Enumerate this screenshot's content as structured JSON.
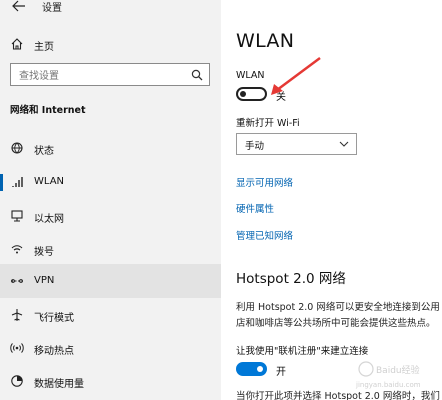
{
  "window": {
    "title": "设置"
  },
  "sidebar": {
    "home_label": "主页",
    "search_placeholder": "查找设置",
    "section_label": "网络和 Internet",
    "items": [
      {
        "label": "状态",
        "icon": "globe-status-icon"
      },
      {
        "label": "WLAN",
        "icon": "wifi-signal-icon"
      },
      {
        "label": "以太网",
        "icon": "ethernet-icon"
      },
      {
        "label": "拨号",
        "icon": "dialup-icon"
      },
      {
        "label": "VPN",
        "icon": "vpn-icon"
      },
      {
        "label": "飞行模式",
        "icon": "airplane-icon"
      },
      {
        "label": "移动热点",
        "icon": "hotspot-icon"
      },
      {
        "label": "数据使用量",
        "icon": "data-usage-icon"
      }
    ]
  },
  "main": {
    "title": "WLAN",
    "wlan_toggle_label": "WLAN",
    "wlan_toggle_state": "关",
    "wlan_enabled": false,
    "reopen_label": "重新打开 Wi-Fi",
    "reopen_selected": "手动",
    "links": [
      "显示可用网络",
      "硬件属性",
      "管理已知网络"
    ],
    "hotspot_title": "Hotspot 2.0 网络",
    "hotspot_desc_line1": "利用 Hotspot 2.0 网络可以更安全地连接到公用 W",
    "hotspot_desc_line2": "店和咖啡店等公共场所中可能会提供这些热点。",
    "register_label": "让我使用\"联机注册\"来建立连接",
    "register_state": "开",
    "register_enabled": true,
    "bottom_text": "当你打开此项并选择 Hotspot 2.0 网络时，我们"
  },
  "colors": {
    "accent": "#0078d7",
    "link": "#0063b1",
    "arrow": "#e53935",
    "sidebar_bg": "#f2f2f2"
  },
  "watermark": {
    "text": "Baidu经验",
    "sub": "jingyan.baidu.com"
  }
}
